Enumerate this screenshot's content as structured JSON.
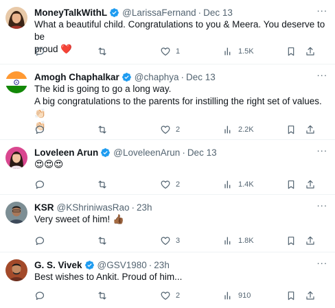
{
  "tweets": [
    {
      "name": "MoneyTalkWithL",
      "handle": "@LarissaFernand",
      "separator": "·",
      "time": "Dec 13",
      "text_lines": [
        "What a beautiful child. Congratulations to you & Meera. You deserve to be",
        "proud"
      ],
      "trailing_emoji": "❤️",
      "replies": "",
      "retweets": "",
      "likes": "1",
      "views": "1.5K",
      "avatar_icon": "woman-portrait-icon"
    },
    {
      "name": "Amogh Chaphalkar",
      "handle": "@chaphya",
      "separator": "·",
      "time": "Dec 13",
      "text_lines": [
        "The kid is going to go a long way.",
        "A big congratulations to the parents for instilling the right set of values. 👏🏻",
        "👏🏻"
      ],
      "replies": "",
      "retweets": "",
      "likes": "2",
      "views": "2.2K",
      "avatar_icon": "india-flag-icon"
    },
    {
      "name": "Loveleen Arun",
      "handle": "@LoveleenArun",
      "separator": "·",
      "time": "Dec 13",
      "text_lines": [
        "😍😍😍"
      ],
      "replies": "",
      "retweets": "",
      "likes": "2",
      "views": "1.4K",
      "avatar_icon": "woman-portrait-icon"
    },
    {
      "name": "KSR",
      "handle": "@KShriniwasRao",
      "separator": "·",
      "time": "23h",
      "text_lines": [
        "Very sweet of him! 👍🏾"
      ],
      "replies": "",
      "retweets": "",
      "likes": "3",
      "views": "1.8K",
      "avatar_icon": "man-portrait-icon"
    },
    {
      "name": "G. S. Vivek",
      "handle": "@GSV1980",
      "separator": "·",
      "time": "23h",
      "text_lines": [
        "Best wishes to Ankit. Proud of him..."
      ],
      "replies": "",
      "retweets": "",
      "likes": "2",
      "views": "910",
      "avatar_icon": "man-portrait-icon"
    }
  ],
  "colors": {
    "text": "#0f1419",
    "secondary": "#536471",
    "verified": "#1d9bf0",
    "divider": "#eff3f4",
    "heart": "#e0245e"
  },
  "more_glyph": "···"
}
